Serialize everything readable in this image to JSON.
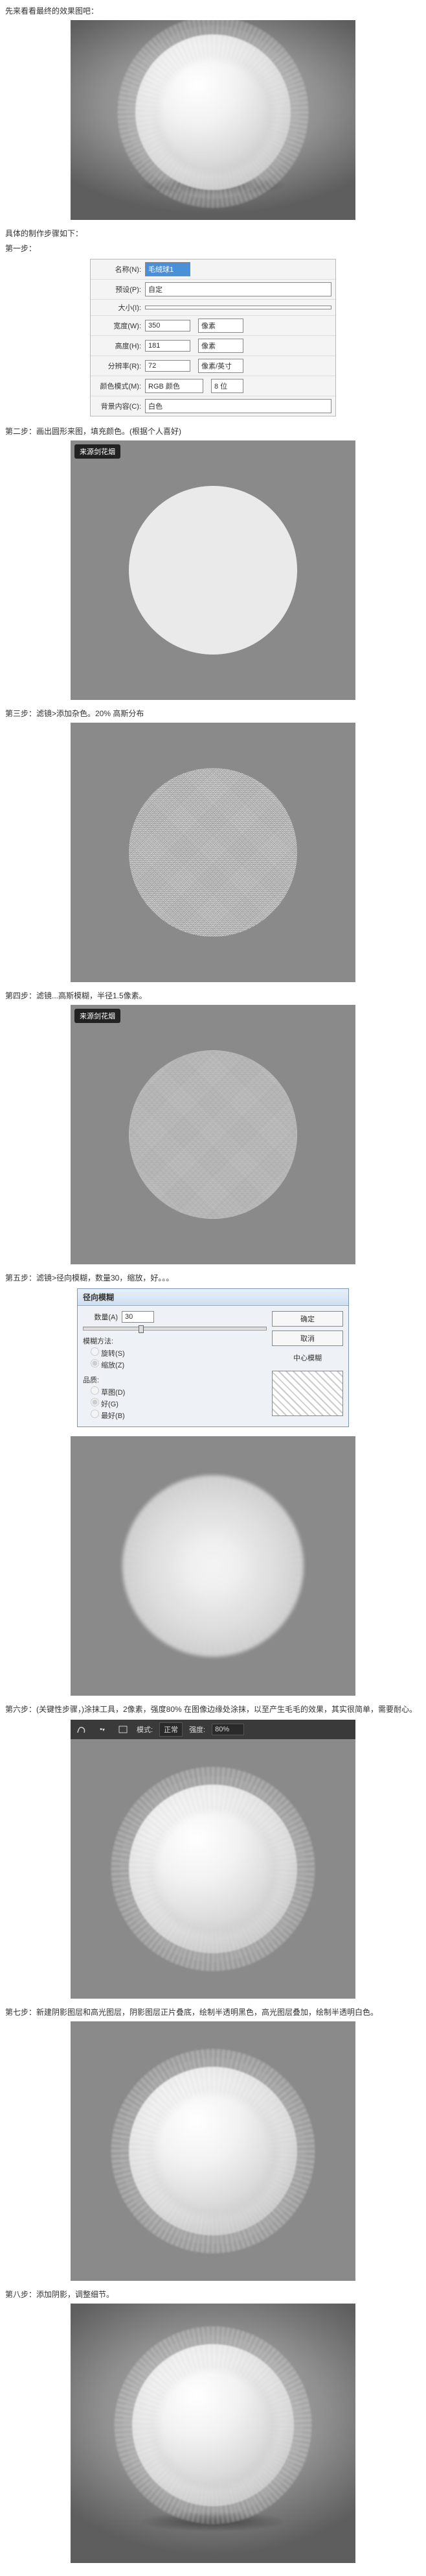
{
  "intro": "先来看看最终的效果图吧：",
  "procedure_heading": "具体的制作步骤如下：",
  "steps": {
    "s1": "第一步：",
    "s2": "第二步：画出圆形来图，填充颜色。(根据个人喜好)",
    "s3": "第三步：滤镜>添加杂色。20% 高斯分布",
    "s4": "第四步：滤镜...高斯模糊，半径1.5像素。",
    "s5": "第五步：滤镜>径向模糊，数量30，缩放，好。。。",
    "s6": "第六步：(关键性步骤，)涂抹工具，2像素，强度80% 在图像边缘处涂抹，以至产生毛毛的效果，其实很简单，需要耐心。",
    "s7": "第七步：新建阴影图层和高光图层，阴影图层正片叠底，绘制半透明黑色，高光图层叠加，绘制半透明白色。",
    "s8": "第八步：添加阴影，调整细节。"
  },
  "badge": "来源剑花烟",
  "new_dialog": {
    "name_lbl": "名称(N):",
    "name_val": "毛绒球1",
    "preset_lbl": "预设(P):",
    "preset_val": "自定",
    "size_lbl": "大小(I):",
    "width_lbl": "宽度(W):",
    "width_val": "350",
    "width_unit": "像素",
    "height_lbl": "高度(H):",
    "height_val": "181",
    "height_unit": "像素",
    "res_lbl": "分辨率(R):",
    "res_val": "72",
    "res_unit": "像素/英寸",
    "mode_lbl": "颜色模式(M):",
    "mode_val": "RGB 颜色",
    "bit_val": "8 位",
    "bg_lbl": "背景内容(C):",
    "bg_val": "白色"
  },
  "radial_dialog": {
    "title": "径向模糊",
    "amount_lbl": "数量(A)",
    "amount_val": "30",
    "ok": "确定",
    "cancel": "取消",
    "method_lbl": "模糊方法:",
    "opt_spin": "旋转(S)",
    "opt_zoom": "缩放(Z)",
    "quality_lbl": "品质:",
    "opt_draft": "草图(D)",
    "opt_good": "好(G)",
    "opt_best": "最好(B)",
    "center_lbl": "中心模糊"
  },
  "ps_toolbar": {
    "mode_lbl": "模式:",
    "mode_val": "正常",
    "strength_lbl": "强度:",
    "strength_val": "80%"
  }
}
